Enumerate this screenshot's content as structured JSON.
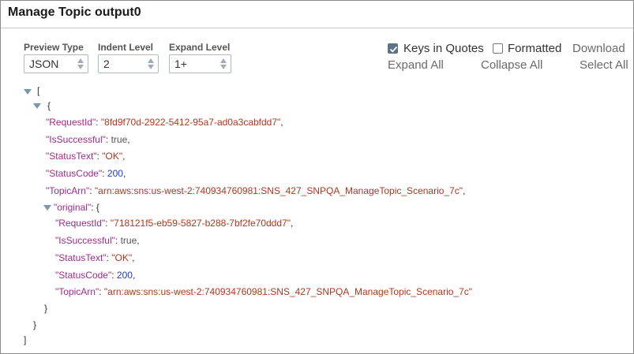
{
  "dialog": {
    "title": "Manage Topic output0"
  },
  "controls": {
    "preview_type": {
      "label": "Preview Type",
      "value": "JSON"
    },
    "indent_level": {
      "label": "Indent Level",
      "value": "2"
    },
    "expand_level": {
      "label": "Expand Level",
      "value": "1+"
    }
  },
  "options": {
    "keys_in_quotes": {
      "label": "Keys in Quotes",
      "checked": true
    },
    "formatted": {
      "label": "Formatted",
      "checked": false
    }
  },
  "actions": {
    "download": "Download",
    "expand_all": "Expand All",
    "collapse_all": "Collapse All",
    "select_all": "Select All"
  },
  "json_view": {
    "colors": {
      "key": "#a02b8c",
      "string": "#b0371f",
      "number": "#1f3bd6",
      "toggle": "#7b95ac"
    },
    "root_open": "[",
    "root_close": "]",
    "obj_open": "{",
    "obj_close": "}",
    "fields": [
      {
        "key": "\"RequestId\"",
        "value": "\"8fd9f70d-2922-5412-95a7-ad0a3cabfdd7\"",
        "suffix": ","
      },
      {
        "key": "\"IsSuccessful\"",
        "value": "true",
        "suffix": ","
      },
      {
        "key": "\"StatusText\"",
        "value": "\"OK\"",
        "suffix": ","
      },
      {
        "key": "\"StatusCode\"",
        "value": "200",
        "suffix": ","
      },
      {
        "key": "\"TopicArn\"",
        "value": "\"arn:aws:sns:us-west-2:740934760981:SNS_427_SNPQA_ManageTopic_Scenario_7c\"",
        "suffix": ","
      }
    ],
    "original": {
      "key": "\"original\"",
      "open": "{",
      "close": "}",
      "fields": [
        {
          "key": "\"RequestId\"",
          "value": "\"718121f5-eb59-5827-b288-7bf2fe70ddd7\"",
          "suffix": ","
        },
        {
          "key": "\"IsSuccessful\"",
          "value": "true",
          "suffix": ","
        },
        {
          "key": "\"StatusText\"",
          "value": "\"OK\"",
          "suffix": ","
        },
        {
          "key": "\"StatusCode\"",
          "value": "200",
          "suffix": ","
        },
        {
          "key": "\"TopicArn\"",
          "value": "\"arn:aws:sns:us-west-2:740934760981:SNS_427_SNPQA_ManageTopic_Scenario_7c\"",
          "suffix": ""
        }
      ]
    }
  }
}
